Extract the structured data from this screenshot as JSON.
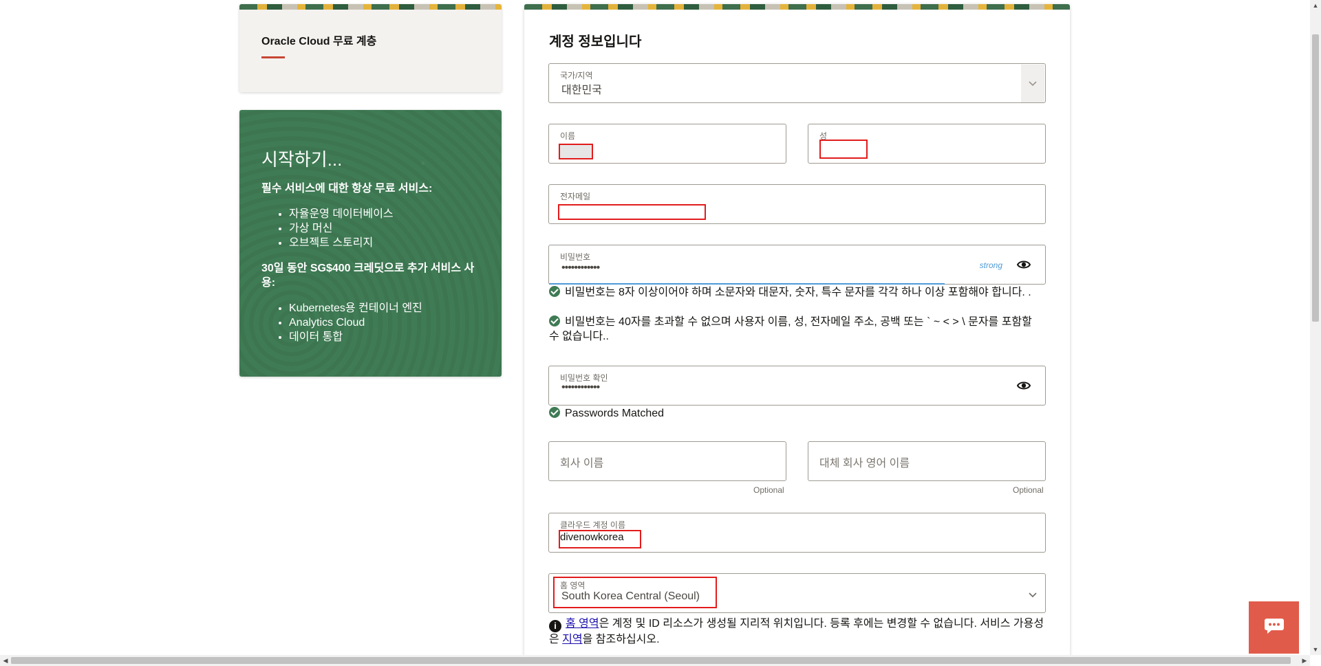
{
  "left": {
    "top_card_title": "Oracle Cloud 무료 계층",
    "get_started": {
      "heading": "시작하기...",
      "always_free_title": "필수 서비스에 대한 항상 무료 서비스:",
      "always_free_items": [
        "자율운영 데이터베이스",
        "가상 머신",
        "오브젝트 스토리지"
      ],
      "trial_title": "30일 동안 SG$400 크레딧으로 추가 서비스 사용:",
      "trial_items": [
        "Kubernetes용 컨테이너 엔진",
        "Analytics Cloud",
        "데이터 통합"
      ]
    }
  },
  "form": {
    "title": "계정 정보입니다",
    "country": {
      "label": "국가/지역",
      "value": "대한민국"
    },
    "first_name": {
      "label": "이름",
      "value": ""
    },
    "last_name": {
      "label": "성",
      "value": ""
    },
    "email": {
      "label": "전자메일",
      "value": ""
    },
    "password": {
      "label": "비밀번호",
      "value": "••••••••••••",
      "strength": "strong"
    },
    "password_rules": [
      "비밀번호는 8자 이상이어야 하며 소문자와 대문자, 숫자, 특수 문자를 각각 하나 이상 포함해야 합니다. .",
      "비밀번호는 40자를 초과할 수 없으며 사용자 이름, 성, 전자메일 주소, 공백 또는 ` ~ < > \\ 문자를 포함할 수 없습니다.."
    ],
    "confirm_password": {
      "label": "비밀번호 확인",
      "value": "••••••••••••",
      "status": "Passwords Matched"
    },
    "company_name": {
      "placeholder": "회사 이름",
      "hint": "Optional"
    },
    "alt_company_name": {
      "placeholder": "대체 회사 영어 이름",
      "hint": "Optional"
    },
    "cloud_account_name": {
      "label": "클라우드 계정 이름",
      "value": "divenowkorea"
    },
    "home_region": {
      "label": "홈 영역",
      "value": "South Korea Central (Seoul)"
    },
    "info": {
      "link1": "홈 영역",
      "text1": "은 계정 및 ID 리소스가 생성될 지리적 위치입니다. 등록 후에는 변경할 수 없습니다. 서비스 가용성은 ",
      "link2": "지역",
      "text2": "을 참조하십시오."
    }
  },
  "colors": {
    "brand_green": "#3f7b54",
    "accent_red": "#c74634",
    "annotation_red": "#e21b1b",
    "chat_button": "#e15b4a"
  }
}
